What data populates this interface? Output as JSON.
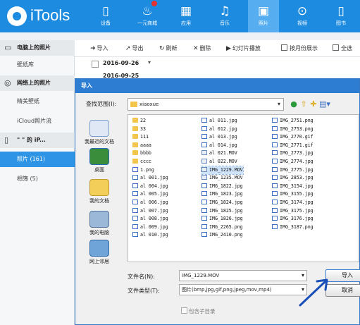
{
  "app": {
    "logo_text": "iTools",
    "accent": "#1d8be0"
  },
  "topnav": [
    {
      "label": "设备",
      "icon": "tablet-icon"
    },
    {
      "label": "一元商城",
      "icon": "cart-icon"
    },
    {
      "label": "应用",
      "icon": "apps-icon"
    },
    {
      "label": "音乐",
      "icon": "music-icon"
    },
    {
      "label": "照片",
      "icon": "photo-icon",
      "active": true
    },
    {
      "label": "视频",
      "icon": "play-icon"
    },
    {
      "label": "图书",
      "icon": "book-icon"
    }
  ],
  "sidebar": {
    "computer_photos": "电脑上的照片",
    "wallpaper": "壁纸库",
    "web_photos": "网络上的照片",
    "fine_wallpaper": "精美壁纸",
    "icloud_stream": "iCloud照片流",
    "device_name": "\" \" 的 iP...",
    "photos": "照片 (161)",
    "albums": "相簿 (5)"
  },
  "toolbar": {
    "import": "导入",
    "export": "导出",
    "refresh": "刷新",
    "delete": "删除",
    "slideshow": "幻灯片播放",
    "by_month": "按月份展示",
    "select_all": "全选"
  },
  "date_group": {
    "date": "2016-09-26",
    "date2": "2016-09-25"
  },
  "dialog": {
    "title": "导入",
    "lookin_label": "查找范围(I):",
    "lookin_value": "xiaoxue",
    "places": [
      "我最近的文档",
      "桌面",
      "我的文档",
      "我的电脑",
      "网上邻居"
    ],
    "files_col1": [
      "22",
      "33",
      "111",
      "aaaa",
      "bbbb",
      "cccc",
      "1.png",
      "al 001.jpg",
      "al 004.jpg",
      "al 005.jpg",
      "al 006.jpg",
      "al 007.jpg",
      "al 008.jpg",
      "al 009.jpg",
      "al 010.jpg"
    ],
    "files_col2": [
      "al 011.jpg",
      "al 012.jpg",
      "al 013.jpg",
      "al 014.jpg",
      "al 021.MOV",
      "al 022.MOV",
      "IMG_1229.MOV",
      "IMG_1235.MOV",
      "IMG_1822.jpg",
      "IMG_1823.jpg",
      "IMG_1824.jpg",
      "IMG_1825.jpg",
      "IMG_1826.jpg",
      "IMG_2265.png",
      "IMG_2410.png"
    ],
    "files_col3": [
      "IMG_2751.png",
      "IMG_2753.png",
      "IMG_2770.gif",
      "IMG_2771.gif",
      "IMG_2773.jpg",
      "IMG_2774.jpg",
      "IMG_2775.jpg",
      "IMG_2853.jpg",
      "IMG_3154.jpg",
      "IMG_3155.jpg",
      "IMG_3174.jpg",
      "IMG_3175.jpg",
      "IMG_3176.jpg",
      "IMG_3187.png"
    ],
    "selected_file": "IMG_1229.MOV",
    "filename_label": "文件名(N):",
    "filename_value": "IMG_1229.MOV",
    "filetype_label": "文件类型(T):",
    "filetype_value": "图片(bmp,jpg,gif,png,jpeg,mov,mp4)",
    "import_button": "导入",
    "cancel_button": "取消",
    "include_subdir": "包含子目录"
  }
}
